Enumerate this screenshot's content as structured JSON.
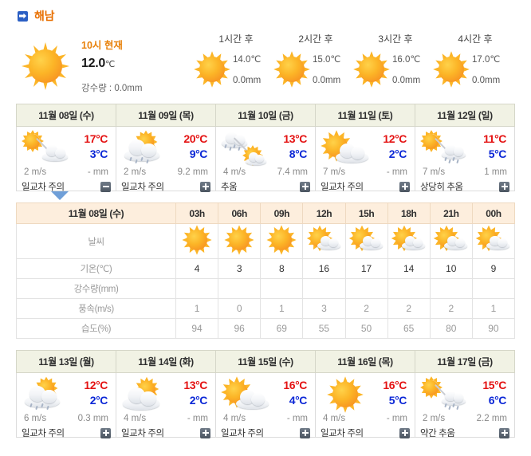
{
  "header": {
    "location": "해남",
    "icon": "location-arrow-icon"
  },
  "current": {
    "label": "10시 현재",
    "temperature": "12.0",
    "unit": "℃",
    "precipitation": "강수량 : 0.0mm",
    "icon": "sunny-icon"
  },
  "hourly_strip": [
    {
      "title": "1시간 후",
      "temp": "14.0℃",
      "rain": "0.0mm",
      "icon": "sunny-icon"
    },
    {
      "title": "2시간 후",
      "temp": "15.0℃",
      "rain": "0.0mm",
      "icon": "sunny-icon"
    },
    {
      "title": "3시간 후",
      "temp": "16.0℃",
      "rain": "0.0mm",
      "icon": "sunny-icon"
    },
    {
      "title": "4시간 후",
      "temp": "17.0℃",
      "rain": "0.0mm",
      "icon": "sunny-icon"
    }
  ],
  "daily_top": [
    {
      "date": "11월 08일 (수)",
      "icon": "sun-then-cloud-icon",
      "high": "17°C",
      "low": "3°C",
      "wind": "2 m/s",
      "rain": "- mm",
      "note": "일교차 주의",
      "toggle": "minus",
      "selected": true
    },
    {
      "date": "11월 09일 (목)",
      "icon": "cloud-sun-rain-icon",
      "high": "20°C",
      "low": "9°C",
      "wind": "2 m/s",
      "rain": "9.2 mm",
      "note": "일교차 주의",
      "toggle": "plus",
      "selected": false
    },
    {
      "date": "11월 10일 (금)",
      "icon": "rain-then-sun-icon",
      "high": "13°C",
      "low": "8°C",
      "wind": "4 m/s",
      "rain": "7.4 mm",
      "note": "추움",
      "toggle": "plus",
      "selected": false
    },
    {
      "date": "11월 11일 (토)",
      "icon": "sun-cloud-icon",
      "high": "12°C",
      "low": "2°C",
      "wind": "7 m/s",
      "rain": "- mm",
      "note": "일교차 주의",
      "toggle": "plus",
      "selected": false
    },
    {
      "date": "11월 12일 (일)",
      "icon": "sun-then-rain-icon",
      "high": "11°C",
      "low": "5°C",
      "wind": "7 m/s",
      "rain": "1 mm",
      "note": "상당히 추움",
      "toggle": "plus",
      "selected": false
    }
  ],
  "hourly_table": {
    "corner_label": "11월 08일 (수)",
    "hours": [
      "03h",
      "06h",
      "09h",
      "12h",
      "15h",
      "18h",
      "21h",
      "00h"
    ],
    "rows": [
      {
        "label": "날씨",
        "type": "icon",
        "values": [
          "sunny-icon",
          "sunny-icon",
          "sunny-icon",
          "sun-cloud-icon",
          "sun-cloud-icon",
          "sun-cloud-icon",
          "sun-cloud-icon",
          "sun-cloud-icon"
        ]
      },
      {
        "label": "기온(℃)",
        "type": "temp",
        "values": [
          "4",
          "3",
          "8",
          "16",
          "17",
          "14",
          "10",
          "9"
        ]
      },
      {
        "label": "강수량(mm)",
        "type": "dim",
        "values": [
          "",
          "",
          "",
          "",
          "",
          "",
          "",
          ""
        ]
      },
      {
        "label": "풍속(m/s)",
        "type": "dim",
        "values": [
          "1",
          "0",
          "1",
          "3",
          "2",
          "2",
          "2",
          "1"
        ]
      },
      {
        "label": "습도(%)",
        "type": "dim",
        "values": [
          "94",
          "96",
          "69",
          "55",
          "50",
          "65",
          "80",
          "90"
        ]
      }
    ]
  },
  "daily_bottom": [
    {
      "date": "11월 13일 (월)",
      "icon": "cloud-sun-rain-icon",
      "high": "12°C",
      "low": "2°C",
      "wind": "6 m/s",
      "rain": "0.3 mm",
      "note": "일교차 주의",
      "toggle": "plus",
      "selected": false
    },
    {
      "date": "11월 14일 (화)",
      "icon": "cloud-sun-icon",
      "high": "13°C",
      "low": "2°C",
      "wind": "4 m/s",
      "rain": "- mm",
      "note": "일교차 주의",
      "toggle": "plus",
      "selected": false
    },
    {
      "date": "11월 15일 (수)",
      "icon": "sun-cloud-icon",
      "high": "16°C",
      "low": "4°C",
      "wind": "4 m/s",
      "rain": "- mm",
      "note": "일교차 주의",
      "toggle": "plus",
      "selected": false
    },
    {
      "date": "11월 16일 (목)",
      "icon": "sunny-icon",
      "high": "16°C",
      "low": "5°C",
      "wind": "4 m/s",
      "rain": "- mm",
      "note": "일교차 주의",
      "toggle": "plus",
      "selected": false
    },
    {
      "date": "11월 17일 (금)",
      "icon": "sun-then-rain-icon",
      "high": "15°C",
      "low": "6°C",
      "wind": "2 m/s",
      "rain": "2.2 mm",
      "note": "약간 추움",
      "toggle": "plus",
      "selected": false
    }
  ],
  "colors": {
    "high": "#e41212",
    "low": "#0b27d6",
    "accent": "#e86f00",
    "sun": "#fcb527"
  }
}
